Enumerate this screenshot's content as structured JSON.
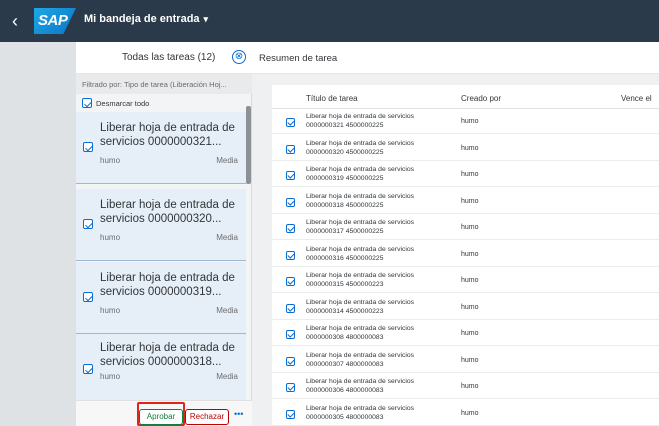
{
  "header": {
    "back_icon": "chevron-left-icon",
    "logo_text": "SAP",
    "app_title": "Mi bandeja de entrada",
    "caret": "▾"
  },
  "master": {
    "title": "Todas las tareas (12)",
    "clear_icon": "⊗",
    "filter_text": "Filtrado por: Tipo de tarea (Liberación Hoj...",
    "deselect_label": "Desmarcar todo",
    "items": [
      {
        "line1": "Liberar hoja de entrada de",
        "line2": "servicios 0000000321...",
        "owner": "humo",
        "priority": "Media"
      },
      {
        "line1": "Liberar hoja de entrada de",
        "line2": "servicios 0000000320...",
        "owner": "humo",
        "priority": "Media"
      },
      {
        "line1": "Liberar hoja de entrada de",
        "line2": "servicios 0000000319...",
        "owner": "humo",
        "priority": "Media"
      },
      {
        "line1": "Liberar hoja de entrada de",
        "line2": "servicios 0000000318...",
        "owner": "humo",
        "priority": "Media"
      }
    ],
    "footer": {
      "approve": "Aprobar",
      "reject": "Rechazar",
      "more": "•••"
    }
  },
  "detail": {
    "title": "Resumen de tarea",
    "columns": {
      "title": "Título de tarea",
      "created_by": "Creado por",
      "due": "Vence el"
    },
    "rows": [
      {
        "l1": "Liberar hoja de entrada de servicios",
        "l2": "0000000321 4500000225",
        "by": "humo"
      },
      {
        "l1": "Liberar hoja de entrada de servicios",
        "l2": "0000000320 4500000225",
        "by": "humo"
      },
      {
        "l1": "Liberar hoja de entrada de servicios",
        "l2": "0000000319 4500000225",
        "by": "humo"
      },
      {
        "l1": "Liberar hoja de entrada de servicios",
        "l2": "0000000318 4500000225",
        "by": "humo"
      },
      {
        "l1": "Liberar hoja de entrada de servicios",
        "l2": "0000000317 4500000225",
        "by": "humo"
      },
      {
        "l1": "Liberar hoja de entrada de servicios",
        "l2": "0000000316 4500000225",
        "by": "humo"
      },
      {
        "l1": "Liberar hoja de entrada de servicios",
        "l2": "0000000315 4500000223",
        "by": "humo"
      },
      {
        "l1": "Liberar hoja de entrada de servicios",
        "l2": "0000000314 4500000223",
        "by": "humo"
      },
      {
        "l1": "Liberar hoja de entrada de servicios",
        "l2": "0000000308 4800000083",
        "by": "humo"
      },
      {
        "l1": "Liberar hoja de entrada de servicios",
        "l2": "0000000307 4800000083",
        "by": "humo"
      },
      {
        "l1": "Liberar hoja de entrada de servicios",
        "l2": "0000000306 4800000083",
        "by": "humo"
      },
      {
        "l1": "Liberar hoja de entrada de servicios",
        "l2": "0000000305 4800000083",
        "by": "humo"
      }
    ]
  }
}
